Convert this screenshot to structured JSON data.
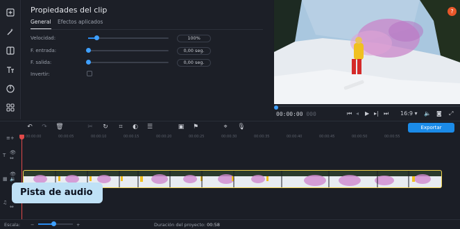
{
  "properties": {
    "title": "Propiedades del clip",
    "tabs": [
      {
        "label": "General",
        "active": true
      },
      {
        "label": "Efectos aplicados",
        "active": false
      }
    ],
    "fields": [
      {
        "label": "Velocidad:",
        "value": "100%",
        "level": 0.1
      },
      {
        "label": "F. entrada:",
        "value": "0,00 seg.",
        "level": 0
      },
      {
        "label": "F. salida:",
        "value": "0,00 seg.",
        "level": 0
      }
    ],
    "invert_label": "Invertir:",
    "invert_checked": false
  },
  "preview": {
    "help_label": "?",
    "timecode_main": "00:00:00",
    "timecode_frames": "000",
    "aspect": "16:9",
    "aspect_chevron": "▾"
  },
  "timeline": {
    "export_label": "Exportar",
    "ruler_ticks": [
      "00:00:00",
      "00:00:05",
      "00:00:10",
      "00:00:15",
      "00:00:20",
      "00:00:25",
      "00:00:30",
      "00:00:35",
      "00:00:40",
      "00:00:45",
      "00:00:50",
      "00:00:55"
    ],
    "tooltip": "Pista de audio",
    "accent_color": "#1b8be8",
    "clip_border_color": "#f0d24a"
  },
  "bottom": {
    "scale_label": "Escala:",
    "duration_label": "Duración del proyecto:",
    "duration_value": "00:58",
    "zoom_level": 0.4
  }
}
